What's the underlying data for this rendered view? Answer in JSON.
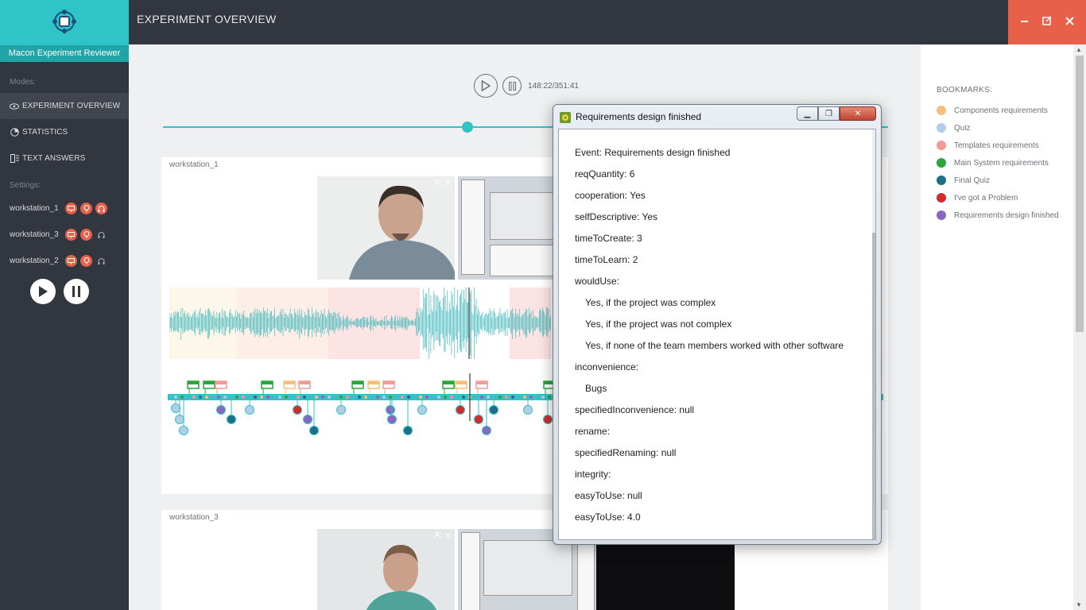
{
  "app": {
    "brand_name": "Macon Experiment Reviewer",
    "page_title": "EXPERIMENT OVERVIEW"
  },
  "sidebar": {
    "modes_heading": "Modes:",
    "modes": [
      {
        "label": "EXPERIMENT OVERVIEW",
        "icon": "eye-icon",
        "active": true
      },
      {
        "label": "STATISTICS",
        "icon": "pie-chart-icon",
        "active": false
      },
      {
        "label": "TEXT ANSWERS",
        "icon": "text-list-icon",
        "active": false
      }
    ],
    "settings_heading": "Settings:",
    "workstations": [
      {
        "label": "workstation_1"
      },
      {
        "label": "workstation_3"
      },
      {
        "label": "workstation_2"
      }
    ]
  },
  "player": {
    "time": "148:22/351:41",
    "progress": 0.42
  },
  "cards": [
    {
      "label": "workstation_1"
    },
    {
      "label": "workstation_3"
    }
  ],
  "bookmarks": {
    "heading": "BOOKMARKS:",
    "items": [
      {
        "label": "Components requirements",
        "color": "#f6c07a"
      },
      {
        "label": "Quiz",
        "color": "#b3cde8"
      },
      {
        "label": "Templates requirements",
        "color": "#f29a93"
      },
      {
        "label": "Main System requirements",
        "color": "#2aa63c"
      },
      {
        "label": "Final Quiz",
        "color": "#1f6f8b"
      },
      {
        "label": "I've got a Problem",
        "color": "#d32a2a"
      },
      {
        "label": "Requirements design finished",
        "color": "#8a67c2"
      }
    ]
  },
  "dialog": {
    "title": "Requirements design finished",
    "lines": [
      {
        "text": "Event: Requirements design finished",
        "indent": false
      },
      {
        "text": "reqQuantity: 6",
        "indent": false
      },
      {
        "text": "cooperation: Yes",
        "indent": false
      },
      {
        "text": "selfDescriptive: Yes",
        "indent": false
      },
      {
        "text": "timeToCreate: 3",
        "indent": false
      },
      {
        "text": "timeToLearn: 2",
        "indent": false
      },
      {
        "text": "wouldUse:",
        "indent": false
      },
      {
        "text": "Yes, if the project was complex",
        "indent": true
      },
      {
        "text": "Yes, if the project was not complex",
        "indent": true
      },
      {
        "text": "Yes, if none of the team members worked with other software",
        "indent": true
      },
      {
        "text": "inconvenience:",
        "indent": false
      },
      {
        "text": "Bugs",
        "indent": true
      },
      {
        "text": "specifiedInconvenience: null",
        "indent": false
      },
      {
        "text": "rename:",
        "indent": false
      },
      {
        "text": "specifiedRenaming: null",
        "indent": false
      },
      {
        "text": "integrity:",
        "indent": false
      },
      {
        "text": "easyToUse: null",
        "indent": false
      },
      {
        "text": "easyToUse: 4.0",
        "indent": false
      }
    ]
  }
}
